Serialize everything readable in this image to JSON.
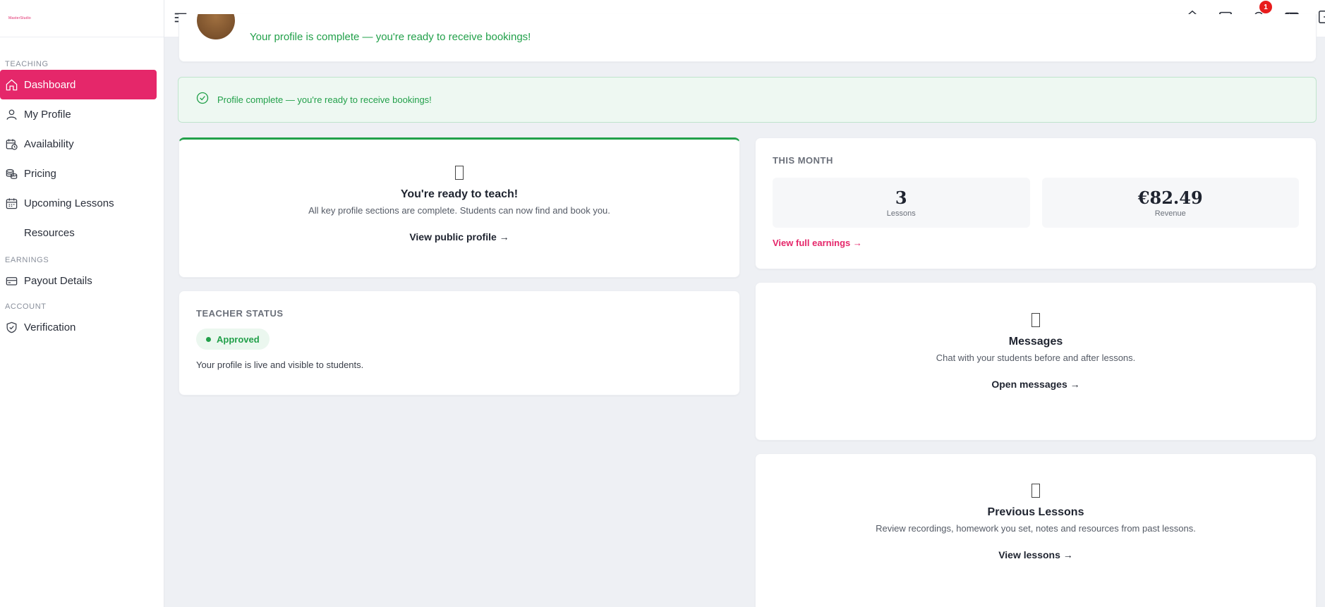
{
  "brand": {
    "logo_text": "MasterStudio",
    "accent": "#e5276a",
    "success": "#22a04a"
  },
  "sidebar": {
    "sections": [
      {
        "label": "TEACHING"
      },
      {
        "label": "EARNINGS"
      },
      {
        "label": "ACCOUNT"
      }
    ],
    "items": [
      {
        "label": "Dashboard",
        "icon": "home-icon",
        "active": true
      },
      {
        "label": "My Profile",
        "icon": "user-icon"
      },
      {
        "label": "Availability",
        "icon": "calendar-clock-icon"
      },
      {
        "label": "Pricing",
        "icon": "coins-icon"
      },
      {
        "label": "Upcoming Lessons",
        "icon": "calendar-icon"
      },
      {
        "label": "Resources",
        "icon": ""
      },
      {
        "label": "Payout Details",
        "icon": "credit-card-icon"
      },
      {
        "label": "Verification",
        "icon": "shield-check-icon"
      }
    ]
  },
  "topbar": {
    "notification_count": "1"
  },
  "profile": {
    "status_line": "Your profile is complete — you're ready to receive bookings!"
  },
  "alert": {
    "text": "Profile complete — you're ready to receive bookings!"
  },
  "teach": {
    "title": "You're ready to teach!",
    "subtitle": "All key profile sections are complete. Students can now find and book you.",
    "link": "View public profile →"
  },
  "status": {
    "label": "TEACHER STATUS",
    "badge": "Approved",
    "text": "Your profile is live and visible to students."
  },
  "month": {
    "label": "THIS MONTH",
    "lessons_value": "3",
    "lessons_label": "Lessons",
    "revenue_value": "€82.49",
    "revenue_label": "Revenue",
    "link": "View full earnings →"
  },
  "messages": {
    "title": "Messages",
    "subtitle": "Chat with your students before and after lessons.",
    "link": "Open messages →"
  },
  "previous": {
    "title": "Previous Lessons",
    "subtitle": "Review recordings, homework you set, notes and resources from past lessons.",
    "link": "View lessons →"
  }
}
